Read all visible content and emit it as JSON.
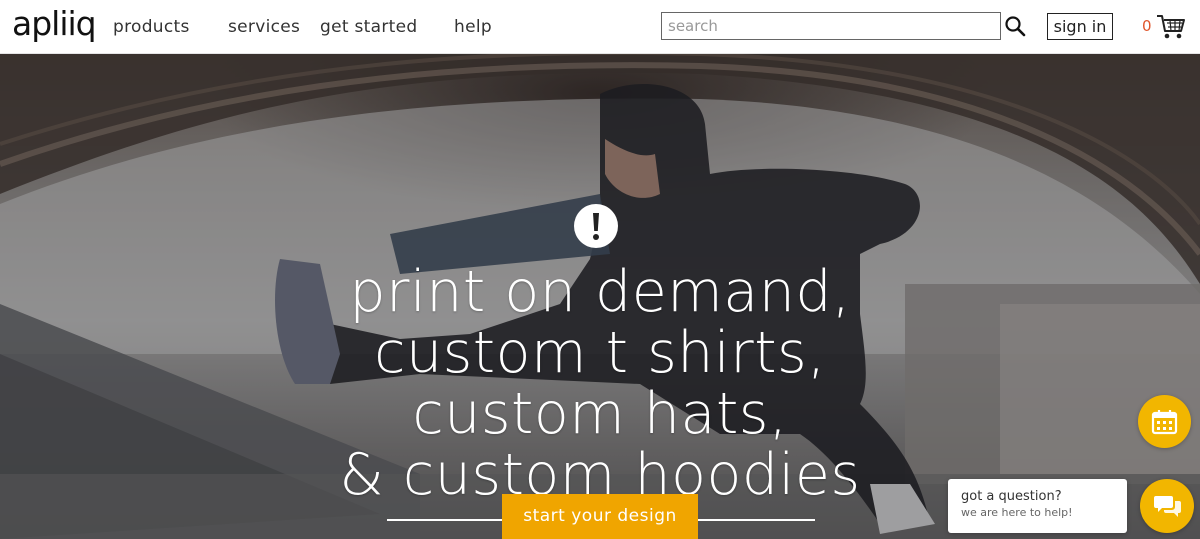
{
  "header": {
    "logo": "apliiq",
    "nav": [
      {
        "label": "products"
      },
      {
        "label": "services"
      },
      {
        "label": "get started"
      },
      {
        "label": "help"
      }
    ],
    "search_placeholder": "search",
    "signin_label": "sign in",
    "cart_count": "0",
    "search_icon": "magnifier-icon",
    "cart_icon": "shopping-cart-icon"
  },
  "hero": {
    "badge_icon": "exclamation-circle-icon",
    "headline": [
      "print on demand,",
      "custom t shirts,",
      "custom hats,",
      "& custom hoodies"
    ],
    "cta_label": "start your design"
  },
  "widgets": {
    "calendar_icon": "calendar-icon",
    "chat_question": "got a question?",
    "chat_subtext": "we are here to help!",
    "chat_icon": "chat-bubbles-icon"
  },
  "colors": {
    "accent": "#f0a500",
    "cart_count": "#e0552b",
    "text": "#333333"
  }
}
